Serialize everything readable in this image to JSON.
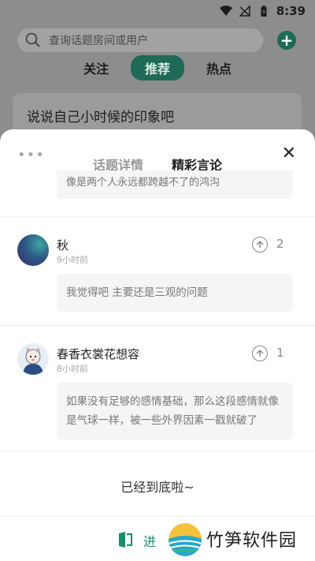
{
  "status_bar": {
    "time": "8:39"
  },
  "search": {
    "placeholder": "查询话题房间或用户"
  },
  "feed_tabs": [
    "关注",
    "推荐",
    "热点"
  ],
  "topic": {
    "title": "说说自己小时候的印象吧"
  },
  "sheet": {
    "tabs": [
      "话题详情",
      "精彩言论"
    ],
    "active_tab": "精彩言论",
    "partial_comment": "像是两个人永远都跨越不了的鸿沟",
    "comments": [
      {
        "name": "秋",
        "time": "9小时前",
        "upvotes": "2",
        "text": "我觉得吧 主要还是三观的问题"
      },
      {
        "name": "春香衣裳花想容",
        "time": "8小时前",
        "upvotes": "1",
        "text": "如果没有足够的感情基础，那么这段感情就像是气球一样，被一些外界因素一戳就破了"
      }
    ],
    "end_text": "已经到底啦~"
  },
  "bottom_bar": {
    "enter_label": "进"
  },
  "watermark": {
    "text": "竹笋软件园"
  },
  "colors": {
    "accent": "#1e6a56",
    "accent_text": "#1e8a6f"
  }
}
